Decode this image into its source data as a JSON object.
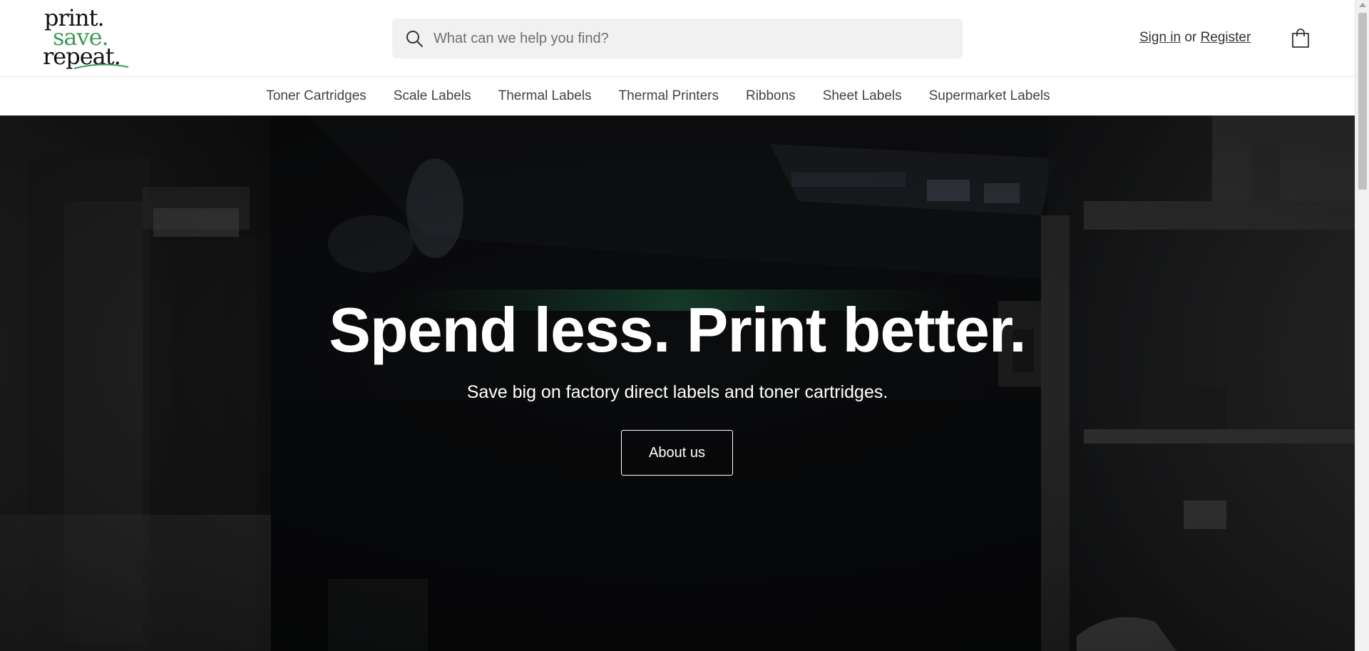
{
  "logo": {
    "line1": "print.",
    "line2": "save.",
    "line3": "repeat.",
    "icon": "swoosh-icon",
    "accent_color": "#3f9a5a"
  },
  "search": {
    "placeholder": "What can we help you find?",
    "icon": "search-icon"
  },
  "account": {
    "sign_in": "Sign in",
    "or": "or",
    "register": "Register"
  },
  "cart": {
    "icon": "shopping-bag-icon"
  },
  "nav": {
    "items": [
      "Toner Cartridges",
      "Scale Labels",
      "Thermal Labels",
      "Thermal Printers",
      "Ribbons",
      "Sheet Labels",
      "Supermarket Labels"
    ]
  },
  "hero": {
    "title": "Spend less. Print better.",
    "subtitle": "Save big on factory direct labels and toner cartridges.",
    "button": "About us"
  }
}
